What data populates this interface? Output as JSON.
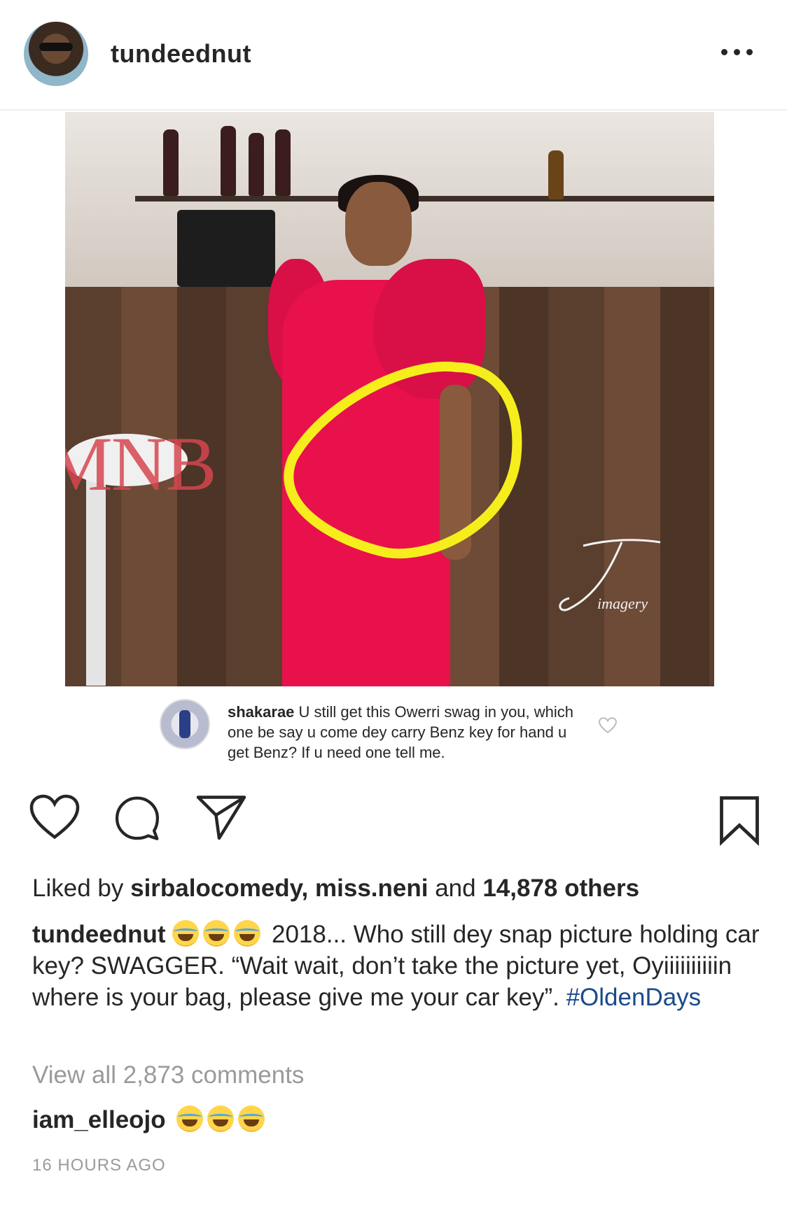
{
  "post": {
    "username": "tundeednut",
    "image": {
      "watermark_left": "MNB",
      "watermark_right": "imagery",
      "embedded_comment": {
        "username": "shakarae",
        "text": "U still get this Owerri swag in you, which one be say u come dey carry Benz key for hand u get Benz? If u need one tell me."
      }
    },
    "likes": {
      "prefix": "Liked by",
      "user1": "sirbalocomedy,",
      "user2": "miss.neni",
      "and": "and",
      "count": "14,878 others"
    },
    "caption": {
      "username": "tundeednut",
      "text": "2018... Who still dey snap picture holding car key? SWAGGER. “Wait wait, don’t take the picture yet, Oyiiiiiiiiiin where is your bag, please give me your car key”.",
      "hashtag": "#OldenDays"
    },
    "view_all": "View all 2,873 comments",
    "comment": {
      "username": "iam_elleojo"
    },
    "timestamp": "16 HOURS AGO"
  },
  "icons": [
    "more-icon",
    "heart-icon",
    "comment-icon",
    "share-icon",
    "bookmark-icon",
    "laughing-emoji",
    "tears-of-joy-emoji"
  ],
  "colors": {
    "text": "#262626",
    "muted": "#9a9a9a",
    "hashtag": "#1a4a8a",
    "highlight_circle": "#f5ee1c",
    "dress": "#e8114c"
  }
}
